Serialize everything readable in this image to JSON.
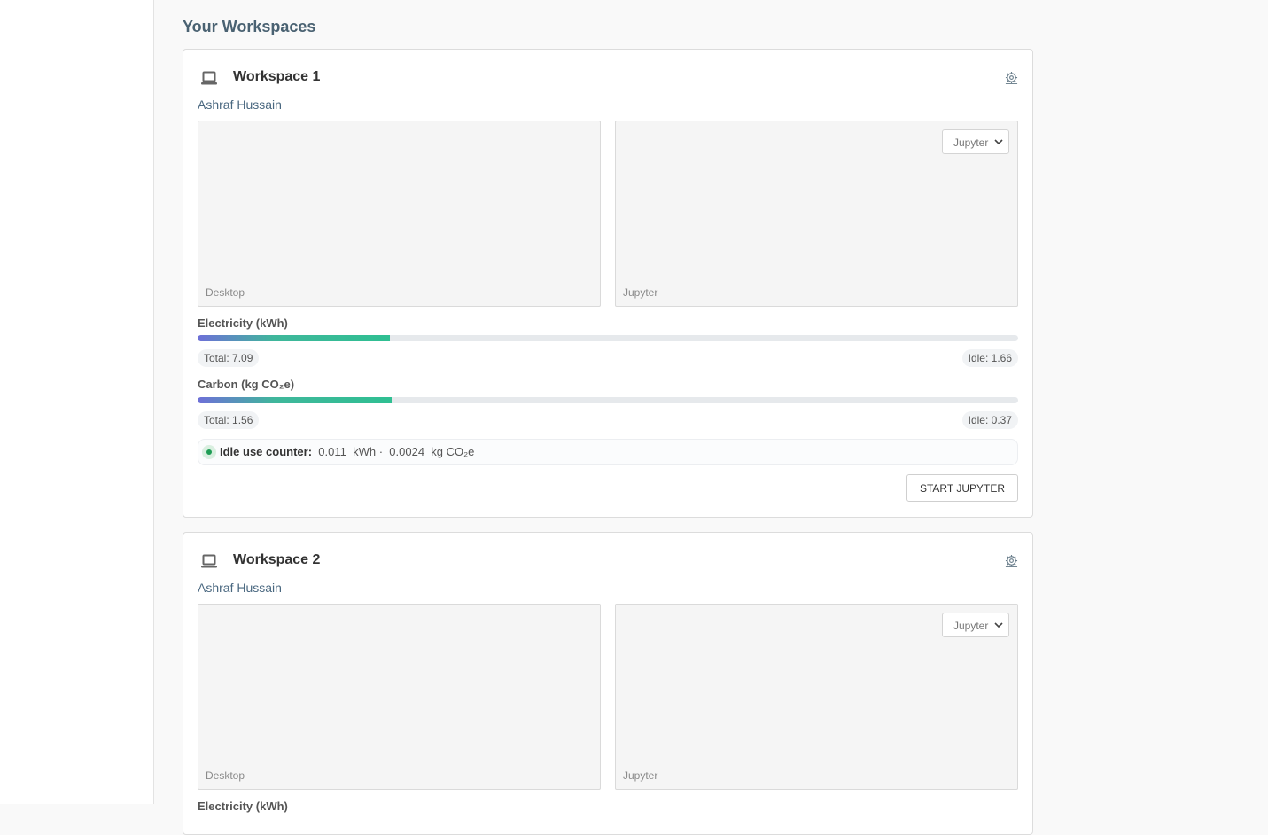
{
  "page": {
    "title": "Your Workspaces"
  },
  "icons": {
    "workspace": "laptop-icon",
    "settings": "gear-icon",
    "select": "chevron-down-icon",
    "status": "status-dot"
  },
  "colors": {
    "bar_gradient_start": "#6e6fd8",
    "bar_gradient_end": "#2fbf92",
    "status_green": "#1f9d55",
    "title": "#4a6272"
  },
  "workspaces": [
    {
      "title": "Workspace 1",
      "owner": "Ashraf Hussain",
      "desktop_label": "Desktop",
      "jupyter_label": "Jupyter",
      "select_value": "Jupyter",
      "electricity": {
        "label": "Electricity (kWh)",
        "progress": 0.234,
        "total": "Total: 7.09",
        "idle": "Idle: 1.66"
      },
      "carbon": {
        "label": "Carbon (kg CO₂e)",
        "progress": 0.237,
        "total": "Total: 1.56",
        "idle": "Idle: 0.37"
      },
      "idle_counter": {
        "label": "Idle use counter:",
        "kwh_value": "0.011",
        "kwh_unit": "kWh",
        "separator": "·",
        "co2_value": "0.0024",
        "co2_unit": "kg CO₂e"
      },
      "action_button": "START JUPYTER"
    },
    {
      "title": "Workspace 2",
      "owner": "Ashraf Hussain",
      "desktop_label": "Desktop",
      "jupyter_label": "Jupyter",
      "select_value": "Jupyter",
      "electricity": {
        "label": "Electricity (kWh)"
      }
    }
  ]
}
